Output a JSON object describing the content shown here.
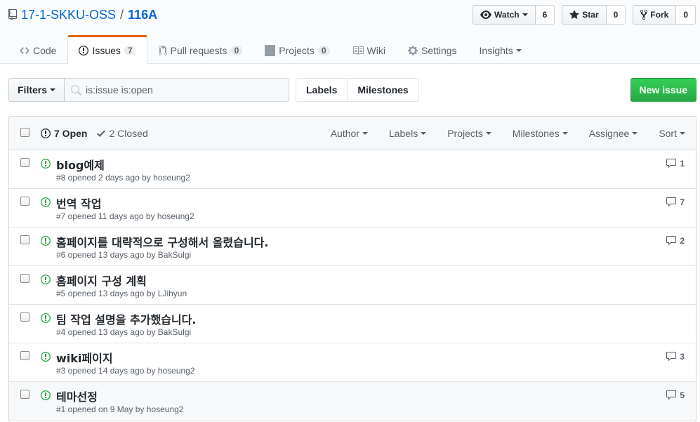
{
  "repo": {
    "owner": "17-1-SKKU-OSS",
    "separator": "/",
    "name": "116A"
  },
  "actions": [
    {
      "label": "Watch",
      "count": "6",
      "icon": "eye-icon"
    },
    {
      "label": "Star",
      "count": "0",
      "icon": "star-icon"
    },
    {
      "label": "Fork",
      "count": "0",
      "icon": "repo-forked-icon"
    }
  ],
  "nav": [
    {
      "label": "Code",
      "icon": "code-icon"
    },
    {
      "label": "Issues",
      "count": "7",
      "icon": "issue-opened-icon",
      "selected": true
    },
    {
      "label": "Pull requests",
      "count": "0",
      "icon": "git-pull-request-icon"
    },
    {
      "label": "Projects",
      "count": "0",
      "icon": "project-icon"
    },
    {
      "label": "Wiki",
      "icon": "book-icon"
    },
    {
      "label": "Settings",
      "icon": "gear-icon"
    },
    {
      "label": "Insights",
      "icon": ""
    }
  ],
  "subnav": {
    "filters_label": "Filters",
    "search_value": "is:issue is:open",
    "labels_label": "Labels",
    "milestones_label": "Milestones",
    "new_issue_label": "New issue"
  },
  "states": {
    "open": "7 Open",
    "closed": "2 Closed"
  },
  "table_filters": [
    "Author",
    "Labels",
    "Projects",
    "Milestones",
    "Assignee",
    "Sort"
  ],
  "issues": [
    {
      "title": "blog예제",
      "meta": "#8 opened 2 days ago by ",
      "author": "hoseung2",
      "comments": "1"
    },
    {
      "title": "번역 작업",
      "meta": "#7 opened 11 days ago by ",
      "author": "hoseung2",
      "comments": "7"
    },
    {
      "title": "홈페이지를 대략적으로 구성해서 올렸습니다.",
      "meta": "#6 opened 13 days ago by ",
      "author": "BakSulgi",
      "comments": "2"
    },
    {
      "title": "홈페이지 구성 계획",
      "meta": "#5 opened 13 days ago by ",
      "author": "LJihyun",
      "comments": ""
    },
    {
      "title": "팀 작업 설명을 추가했습니다.",
      "meta": "#4 opened 13 days ago by ",
      "author": "BakSulgi",
      "comments": ""
    },
    {
      "title": "wiki페이지",
      "meta": "#3 opened 14 days ago by ",
      "author": "hoseung2",
      "comments": "3"
    },
    {
      "title": "테마선정",
      "meta": "#1 opened on 9 May by ",
      "author": "hoseung2",
      "comments": "5"
    }
  ],
  "colors": {
    "link": "#0366d6",
    "open_green": "#28a745",
    "selected_tab": "#e36209"
  }
}
